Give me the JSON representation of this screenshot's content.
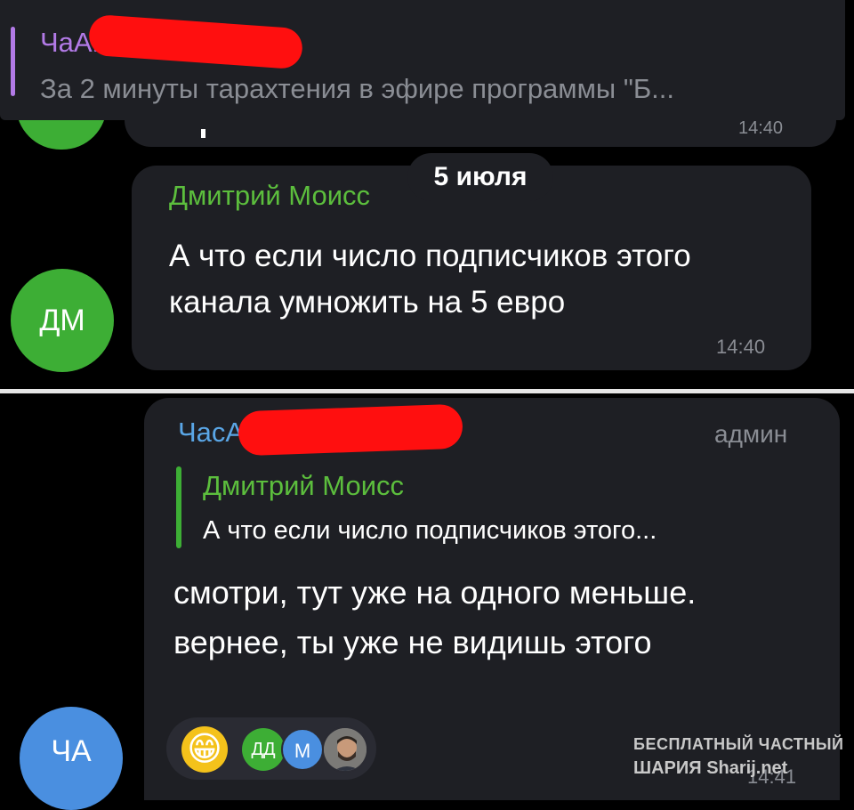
{
  "pinned": {
    "title": "ЧаАРИЯ",
    "text": "За 2 минуты тарахтения в эфире программы \"Б..."
  },
  "previous_message": {
    "time": "14:40"
  },
  "date_separator": "5 июля",
  "message1": {
    "avatar": "ДМ",
    "author": "Дмитрий Моисс",
    "text": "А что если число подписчиков этого канала умножить на 5 евро",
    "time": "14:40"
  },
  "message2": {
    "avatar": "ЧА",
    "author": "ЧасАРИЯ Chat",
    "role": "админ",
    "reply": {
      "author": "Дмитрий Моисс",
      "text": "А что если число подписчиков этого..."
    },
    "text": "смотри, тут уже на одного меньше. вернее, ты уже не видишь этого",
    "time": "14:41",
    "reaction": {
      "emoji": "😁",
      "users": [
        "ДД",
        "М"
      ]
    }
  },
  "watermark": {
    "line1": "БЕСПЛАТНЫЙ ЧАСТНЫЙ",
    "line2": "ШАРИЯ Sharij.net"
  },
  "colors": {
    "background": "#000000",
    "bubble": "#1e1f24",
    "green_name": "#5cbe3d",
    "blue_name": "#5aa6e6",
    "purple_name": "#b27ae6",
    "redaction": "#ff0f0f"
  }
}
